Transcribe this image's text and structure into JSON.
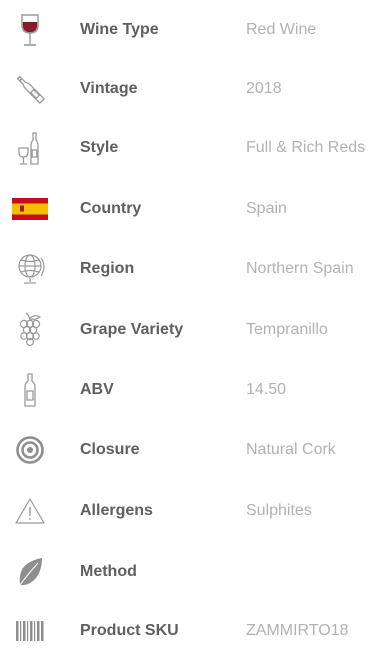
{
  "specs": [
    {
      "label": "Wine Type",
      "value": "Red Wine",
      "icon": "wine-glass-icon"
    },
    {
      "label": "Vintage",
      "value": "2018",
      "icon": "bottle-icon"
    },
    {
      "label": "Style",
      "value": "Full & Rich Reds",
      "icon": "bottle-glass-icon"
    },
    {
      "label": "Country",
      "value": "Spain",
      "icon": "spain-flag-icon"
    },
    {
      "label": "Region",
      "value": "Northern Spain",
      "icon": "globe-icon"
    },
    {
      "label": "Grape Variety",
      "value": "Tempranillo",
      "icon": "grapes-icon"
    },
    {
      "label": "ABV",
      "value": "14.50",
      "icon": "small-bottle-icon"
    },
    {
      "label": "Closure",
      "value": "Natural Cork",
      "icon": "cork-target-icon"
    },
    {
      "label": "Allergens",
      "value": "Sulphites",
      "icon": "warning-icon"
    },
    {
      "label": "Method",
      "value": "",
      "icon": "leaf-icon"
    },
    {
      "label": "Product SKU",
      "value": "ZAMMIRTO18",
      "icon": "barcode-icon"
    }
  ],
  "colors": {
    "label": "#5f5f5f",
    "value": "#b2b2b2",
    "wine": "#8a1a2a",
    "flag_red": "#c60b1e",
    "flag_yellow": "#f1bf00"
  }
}
